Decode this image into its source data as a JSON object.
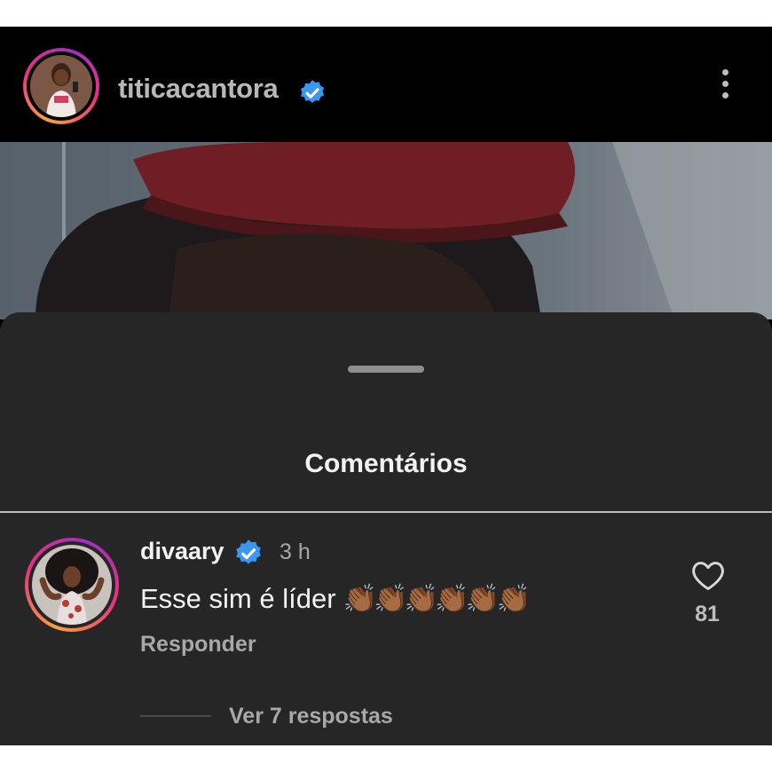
{
  "post": {
    "author": "titicacantora",
    "author_verified": true,
    "more_icon": "more-vertical-icon"
  },
  "comments_sheet": {
    "title": "Comentários",
    "comments": [
      {
        "username": "divaary",
        "verified": true,
        "time": "3 h",
        "text": "Esse sim é líder",
        "emoji": "👏🏾👏🏾👏🏾👏🏾👏🏾👏🏾",
        "reply_label": "Responder",
        "like_count": "81",
        "view_replies_label": "Ver 7 respostas"
      }
    ]
  },
  "colors": {
    "sheet_background": "#262626",
    "verified_blue": "#3897f0",
    "story_ring": [
      "#f9a13a",
      "#e9317f",
      "#a12fc0"
    ]
  }
}
